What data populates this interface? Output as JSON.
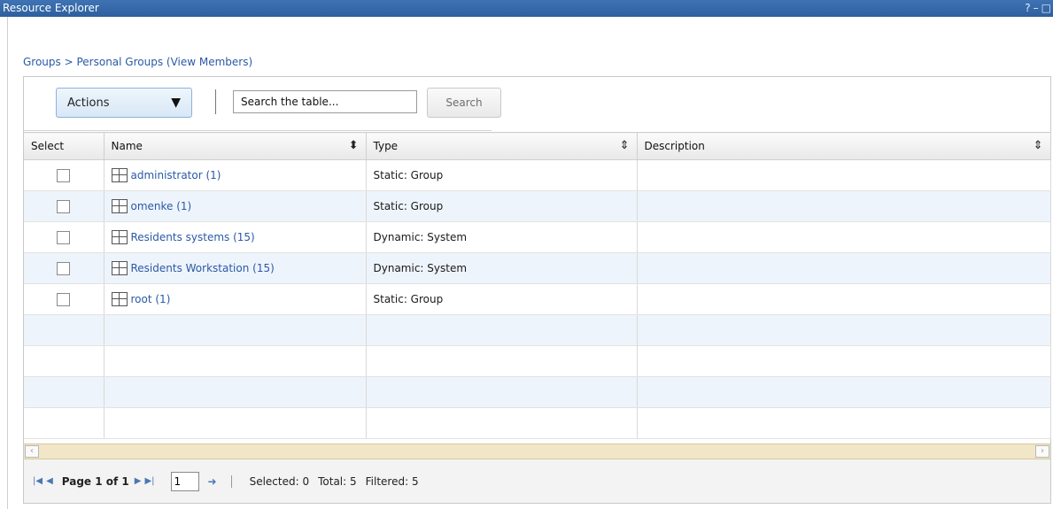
{
  "window": {
    "title": "Resource Explorer",
    "help": "?",
    "minimize": "–",
    "maximize": "□"
  },
  "breadcrumb": "Groups > Personal Groups (View Members)",
  "toolbar": {
    "actions_label": "Actions",
    "search_value": "Search the table...",
    "search_button": "Search"
  },
  "columns": [
    "Select",
    "Name",
    "Type",
    "Description"
  ],
  "rows": [
    {
      "name": "administrator (1)",
      "type": "Static: Group",
      "description": ""
    },
    {
      "name": "omenke (1)",
      "type": "Static: Group",
      "description": ""
    },
    {
      "name": "Residents systems (15)",
      "type": "Dynamic: System",
      "description": ""
    },
    {
      "name": "Residents Workstation (15)",
      "type": "Dynamic: System",
      "description": ""
    },
    {
      "name": "root (1)",
      "type": "Static: Group",
      "description": ""
    }
  ],
  "pager": {
    "page_label": "Page 1 of 1",
    "page_input": "1",
    "selected": "Selected: 0",
    "total": "Total: 5",
    "filtered": "Filtered: 5"
  }
}
